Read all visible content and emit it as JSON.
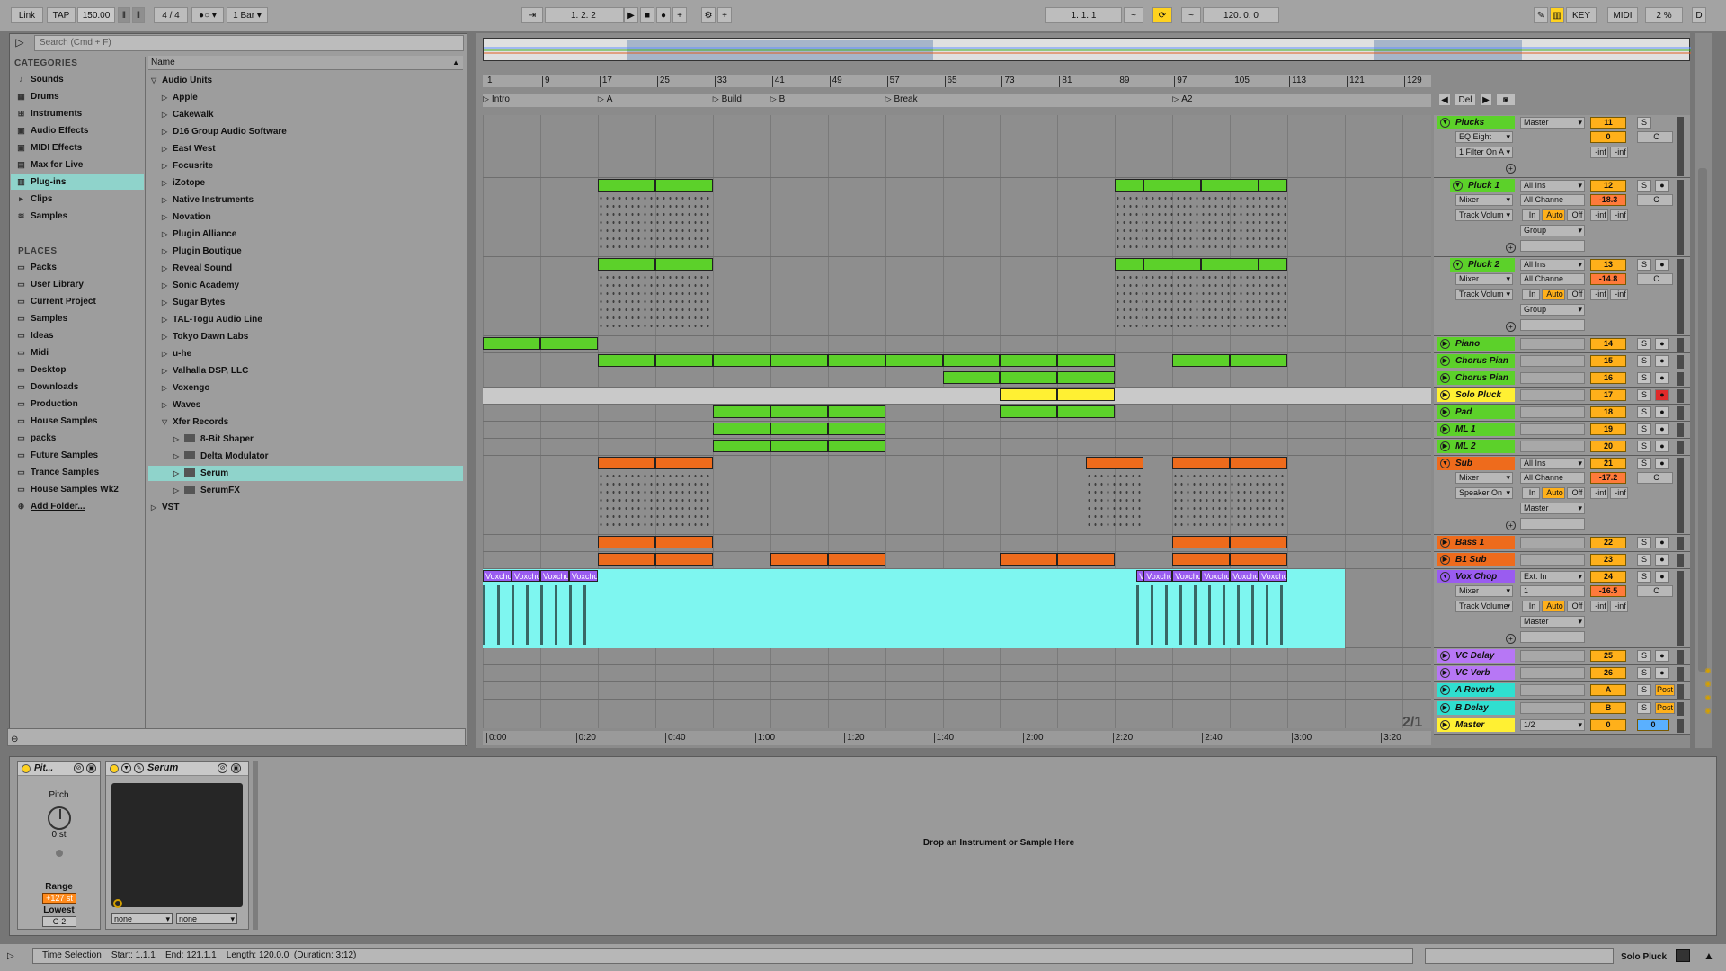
{
  "transport": {
    "link": "Link",
    "tap": "TAP",
    "tempo": "150.00",
    "signature": "4 / 4",
    "quantize": "1 Bar",
    "position": "1.   2.   2",
    "loop_start": "1.   1.   1",
    "loop_length": "120.   0.   0",
    "key": "KEY",
    "midi": "MIDI",
    "cpu": "2 %",
    "d": "D"
  },
  "browser": {
    "search_placeholder": "Search (Cmd + F)",
    "categories_header": "CATEGORIES",
    "categories": [
      {
        "label": "Sounds",
        "icon": "note-icon"
      },
      {
        "label": "Drums",
        "icon": "grid-icon"
      },
      {
        "label": "Instruments",
        "icon": "keys-icon"
      },
      {
        "label": "Audio Effects",
        "icon": "fx-icon"
      },
      {
        "label": "MIDI Effects",
        "icon": "fx-icon"
      },
      {
        "label": "Max for Live",
        "icon": "m4l-icon"
      },
      {
        "label": "Plug-ins",
        "icon": "plug-icon"
      },
      {
        "label": "Clips",
        "icon": "clip-icon"
      },
      {
        "label": "Samples",
        "icon": "wave-icon"
      }
    ],
    "places_header": "PLACES",
    "places": [
      "Packs",
      "User Library",
      "Current Project",
      "Samples",
      "Ideas",
      "Midi",
      "Desktop",
      "Downloads",
      "Production",
      "House Samples",
      "packs",
      "Future Samples",
      "Trance Samples",
      "House Samples Wk2"
    ],
    "add_folder": "Add Folder...",
    "name_header": "Name",
    "tree_root": "Audio Units",
    "tree_items": [
      "Apple",
      "Cakewalk",
      "D16 Group Audio Software",
      "East West",
      "Focusrite",
      "iZotope",
      "Native Instruments",
      "Novation",
      "Plugin Alliance",
      "Plugin Boutique",
      "Reveal Sound",
      "Sonic Academy",
      "Sugar Bytes",
      "TAL-Togu Audio Line",
      "Tokyo Dawn Labs",
      "u-he",
      "Valhalla DSP, LLC",
      "Voxengo",
      "Waves",
      "Xfer Records"
    ],
    "xfer_children": [
      "8-Bit Shaper",
      "Delta Modulator",
      "Serum",
      "SerumFX"
    ],
    "vst": "VST"
  },
  "ruler": {
    "bars": [
      "1",
      "9",
      "17",
      "25",
      "33",
      "41",
      "49",
      "57",
      "65",
      "73",
      "81",
      "89",
      "97",
      "105",
      "113",
      "121",
      "129"
    ],
    "locators": [
      "Intro",
      "A",
      "Build",
      "B",
      "Break",
      "A2"
    ],
    "times": [
      "0:00",
      "0:20",
      "0:40",
      "1:00",
      "1:20",
      "1:40",
      "2:00",
      "2:20",
      "2:40",
      "3:00",
      "3:20"
    ],
    "zoom": "2/1",
    "del": "Del"
  },
  "tracks": [
    {
      "name": "Plucks",
      "color": "#5cd12a",
      "io": "Master",
      "num": "11",
      "sub1": "EQ Eight",
      "sub2": "1 Filter On A",
      "vol": "0",
      "pan": "C"
    },
    {
      "name": "Pluck 1",
      "color": "#5cd12a",
      "io": "All Ins",
      "num": "12",
      "sub1": "Mixer",
      "sub2": "Track Volum",
      "vol": "-18.3",
      "pan": "C",
      "ch": "All Channe",
      "grp": "Group"
    },
    {
      "name": "Pluck 2",
      "color": "#5cd12a",
      "io": "All Ins",
      "num": "13",
      "sub1": "Mixer",
      "sub2": "Track Volum",
      "vol": "-14.8",
      "pan": "C",
      "ch": "All Channe",
      "grp": "Group"
    },
    {
      "name": "Piano",
      "color": "#5cd12a",
      "num": "14"
    },
    {
      "name": "Chorus Pian",
      "color": "#5cd12a",
      "num": "15"
    },
    {
      "name": "Chorus Pian",
      "color": "#5cd12a",
      "num": "16"
    },
    {
      "name": "Solo Pluck",
      "color": "#fff033",
      "num": "17"
    },
    {
      "name": "Pad",
      "color": "#5cd12a",
      "num": "18"
    },
    {
      "name": "ML 1",
      "color": "#5cd12a",
      "num": "19"
    },
    {
      "name": "ML 2",
      "color": "#5cd12a",
      "num": "20"
    },
    {
      "name": "Sub",
      "color": "#ee6b1c",
      "io": "All Ins",
      "num": "21",
      "sub1": "Mixer",
      "sub2": "Speaker On",
      "vol": "-17.2",
      "pan": "C",
      "ch": "All Channe",
      "grp": "Master"
    },
    {
      "name": "Bass 1",
      "color": "#ee6b1c",
      "num": "22"
    },
    {
      "name": "B1 Sub",
      "color": "#ee6b1c",
      "num": "23"
    },
    {
      "name": "Vox Chop",
      "color": "#9a5cf0",
      "io": "Ext. In",
      "num": "24",
      "sub1": "Mixer",
      "sub2": "Track Volume",
      "vol": "-16.5",
      "pan": "C",
      "ch": "1",
      "grp": "Master"
    },
    {
      "name": "VC Delay",
      "color": "#b777f5",
      "num": "25"
    },
    {
      "name": "VC Verb",
      "color": "#b777f5",
      "num": "26"
    },
    {
      "name": "A Reverb",
      "color": "#2fdfd0",
      "num": "A",
      "post": "Post"
    },
    {
      "name": "B Delay",
      "color": "#2fdfd0",
      "num": "B",
      "post": "Post"
    },
    {
      "name": "Master",
      "color": "#fff033",
      "io": "1/2",
      "num": "0",
      "vol2": "0"
    }
  ],
  "clips": {
    "voxchop_label": "Voxchop",
    "vox_a2_first": "Voxcho"
  },
  "detail": {
    "pitch_device": "Pit...",
    "pitch_label": "Pitch",
    "pitch_value": "0 st",
    "range_label": "Range",
    "range_value": "+127 st",
    "lowest_label": "Lowest",
    "lowest_value": "C-2",
    "serum_device": "Serum",
    "serum_none1": "none",
    "serum_none2": "none",
    "drop_text": "Drop an Instrument or Sample Here"
  },
  "status": {
    "selection": "Time Selection",
    "start": "Start: 1.1.1",
    "end": "End: 121.1.1",
    "length": "Length: 120.0.0",
    "duration": "(Duration: 3:12)",
    "track_sel": "Solo Pluck"
  },
  "misc": {
    "in": "In",
    "auto": "Auto",
    "off": "Off",
    "inf": "-inf",
    "s": "S"
  }
}
